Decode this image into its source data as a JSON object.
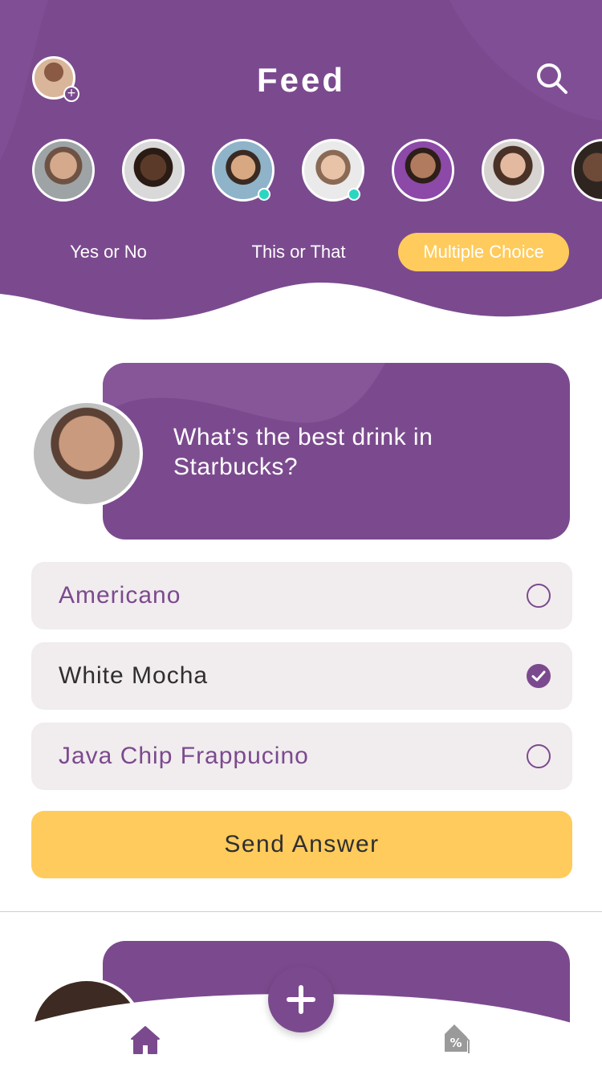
{
  "header": {
    "title": "Feed",
    "tabs": [
      {
        "label": "Yes or No"
      },
      {
        "label": "This or That"
      },
      {
        "label": "Multiple Choice",
        "active": true
      }
    ],
    "stories_count_visible": 7,
    "icons": {
      "search": "search-icon",
      "add": "plus-icon"
    }
  },
  "question": {
    "text": "What’s the best drink in Starbucks?",
    "options": [
      {
        "label": "Americano",
        "selected": false
      },
      {
        "label": "White Mocha",
        "selected": true
      },
      {
        "label": "Java Chip Frappucino",
        "selected": false
      }
    ],
    "submit_label": "Send Answer"
  },
  "bottom_nav": {
    "items": [
      {
        "icon": "home-icon"
      },
      {
        "icon": "add-icon"
      },
      {
        "icon": "discount-tag-icon"
      }
    ]
  },
  "colors": {
    "primary_purple": "#7b4a8e",
    "accent_yellow": "#ffcb5c",
    "option_bg": "#f1ecee",
    "online_dot": "#2ad6c1"
  }
}
